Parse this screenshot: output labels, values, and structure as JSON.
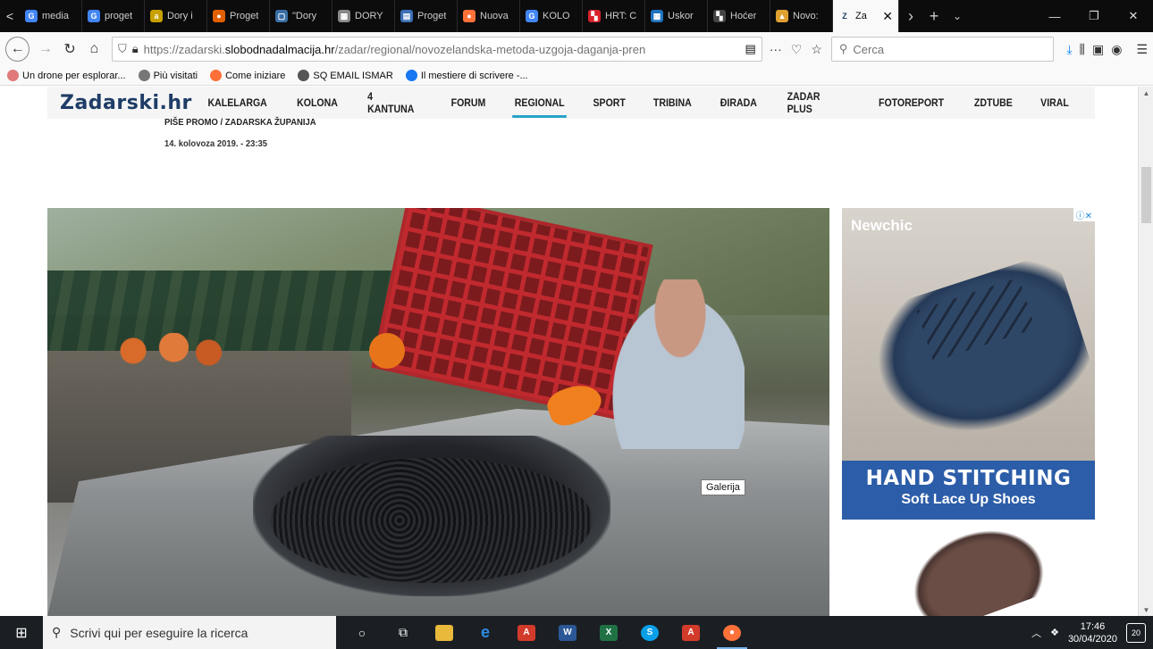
{
  "tabs": [
    {
      "title": "media",
      "color": "#4285f4",
      "glyph": "G"
    },
    {
      "title": "proget",
      "color": "#4285f4",
      "glyph": "G"
    },
    {
      "title": "Dory i",
      "color": "#c8a000",
      "glyph": "a"
    },
    {
      "title": "Proget",
      "color": "#e06000",
      "glyph": "●"
    },
    {
      "title": "\"Dory",
      "color": "#3a6ea5",
      "glyph": "▢"
    },
    {
      "title": "DORY",
      "color": "#888888",
      "glyph": "▦"
    },
    {
      "title": "Proget",
      "color": "#3b6fb6",
      "glyph": "▤"
    },
    {
      "title": "Nuova",
      "color": "#ff7139",
      "glyph": "●"
    },
    {
      "title": "KOLO",
      "color": "#4285f4",
      "glyph": "G"
    },
    {
      "title": "HRT: C",
      "color": "#d8232a",
      "glyph": "▚"
    },
    {
      "title": "Uskor",
      "color": "#1e73be",
      "glyph": "▦"
    },
    {
      "title": "Hoćer",
      "color": "#444444",
      "glyph": "▚"
    },
    {
      "title": "Novo:",
      "color": "#e0a030",
      "glyph": "▲"
    }
  ],
  "active_tab": {
    "title": "Za",
    "glyph": "Z"
  },
  "url": {
    "prefix": "https://zadarski.",
    "domain": "slobodnadalmacija.hr",
    "path": "/zadar/regional/novozelandska-metoda-uzgoja-daganja-pren"
  },
  "search_placeholder": "Cerca",
  "bookmarks": [
    {
      "label": "Un drone per esplorar...",
      "color": "#e07a7a"
    },
    {
      "label": "Più visitati",
      "color": "#777777"
    },
    {
      "label": "Come iniziare",
      "color": "#ff7139"
    },
    {
      "label": "SQ EMAIL ISMAR",
      "color": "#555555"
    },
    {
      "label": "Il mestiere di scrivere -...",
      "color": "#1877f2"
    }
  ],
  "site": {
    "logo": "Zadarski",
    "logo_suffix": ".hr",
    "menu": [
      "KALELARGA",
      "KOLONA",
      "4 KANTUNA",
      "FORUM",
      "REGIONAL",
      "SPORT",
      "TRIBINA",
      "ĐIRADA",
      "ZADAR PLUS",
      "FOTOREPORT",
      "ZDTUBE",
      "VIRAL"
    ],
    "active_menu": "REGIONAL"
  },
  "article": {
    "byline": "PIŠE PROMO / ZADARSKA ŽUPANIJA",
    "date": "14. kolovoza 2019. - 23:35",
    "tooltip": "Galerija"
  },
  "ad": {
    "brand": "Newchic",
    "headline": "HAND STITCHING",
    "subline": "Soft Lace Up Shoes",
    "adchoice": "ⓘ✕"
  },
  "taskbar": {
    "search_placeholder": "Scrivi qui per eseguire la ricerca",
    "time": "17:46",
    "date": "30/04/2020",
    "notifications": "20"
  }
}
